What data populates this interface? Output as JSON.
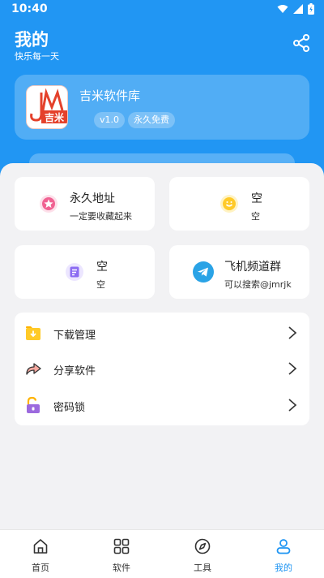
{
  "status_bar": {
    "time": "10:40"
  },
  "header": {
    "title": "我的",
    "subtitle": "快乐每一天"
  },
  "app_card": {
    "name": "吉米软件库",
    "logo_text": "吉米",
    "version": "v1.0",
    "license": "永久免费"
  },
  "tiles": [
    {
      "title": "永久地址",
      "subtitle": "一定要收藏起来",
      "icon": "star-badge-icon"
    },
    {
      "title": "空",
      "subtitle": "空",
      "icon": "smiley-chat-icon"
    },
    {
      "title": "空",
      "subtitle": "空",
      "icon": "note-icon"
    },
    {
      "title": "飞机频道群",
      "subtitle": "可以搜索@jmrjk",
      "icon": "telegram-icon"
    }
  ],
  "menu": [
    {
      "label": "下载管理",
      "icon": "download-folder-icon"
    },
    {
      "label": "分享软件",
      "icon": "share-arrow-icon"
    },
    {
      "label": "密码锁",
      "icon": "padlock-icon"
    }
  ],
  "tabbar": [
    {
      "label": "首页",
      "icon": "home-icon"
    },
    {
      "label": "软件",
      "icon": "grid-icon"
    },
    {
      "label": "工具",
      "icon": "compass-icon"
    },
    {
      "label": "我的",
      "icon": "user-icon",
      "active": true
    }
  ],
  "colors": {
    "primary": "#2196f3",
    "background": "#f2f2f4",
    "accent_red": "#e4412b"
  }
}
